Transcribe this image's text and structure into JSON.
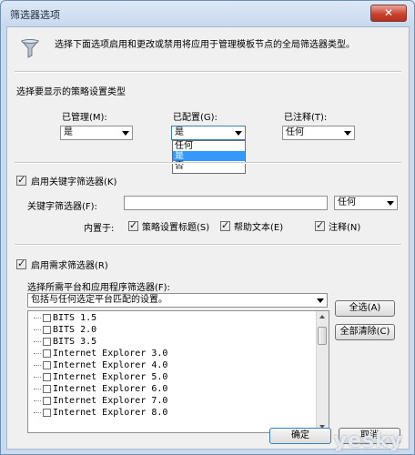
{
  "window": {
    "title": "筛选器选项",
    "close_label": "✕"
  },
  "header": {
    "description": "选择下面选项启用和更改或禁用将应用于管理模板节点的全局筛选器类型。",
    "icon": "funnel-icon"
  },
  "policy_types": {
    "section_label": "选择要显示的策略设置类型",
    "managed": {
      "label": "已管理(M):",
      "value": "是"
    },
    "configured": {
      "label": "已配置(G):",
      "value": "是",
      "options": [
        "任何",
        "是",
        "否"
      ],
      "selected_index": 1
    },
    "commented": {
      "label": "已注释(T):",
      "value": "任何"
    }
  },
  "keyword_filter": {
    "enable_label": "启用关键字筛选器(K)",
    "enabled": true,
    "field_label": "关键字筛选器(F):",
    "field_value": "",
    "match_value": "任何",
    "within_label": "内置于:",
    "options": [
      {
        "label": "策略设置标题(S)",
        "checked": true
      },
      {
        "label": "帮助文本(E)",
        "checked": true
      },
      {
        "label": "注释(N)",
        "checked": true
      }
    ]
  },
  "requirements_filter": {
    "enable_label": "启用需求筛选器(R)",
    "enabled": true,
    "platform_label": "选择所需平台和应用程序筛选器(F):",
    "platform_value": "包括与任何选定平台匹配的设置。",
    "select_all_label": "全选(A)",
    "clear_all_label": "全部清除(C)",
    "items": [
      "BITS 1.5",
      "BITS 2.0",
      "BITS 3.5",
      "Internet Explorer 3.0",
      "Internet Explorer 4.0",
      "Internet Explorer 5.0",
      "Internet Explorer 6.0",
      "Internet Explorer 7.0",
      "Internet Explorer 8.0"
    ]
  },
  "footer": {
    "ok_label": "确定",
    "cancel_label": "取消"
  },
  "watermark": "yesky"
}
